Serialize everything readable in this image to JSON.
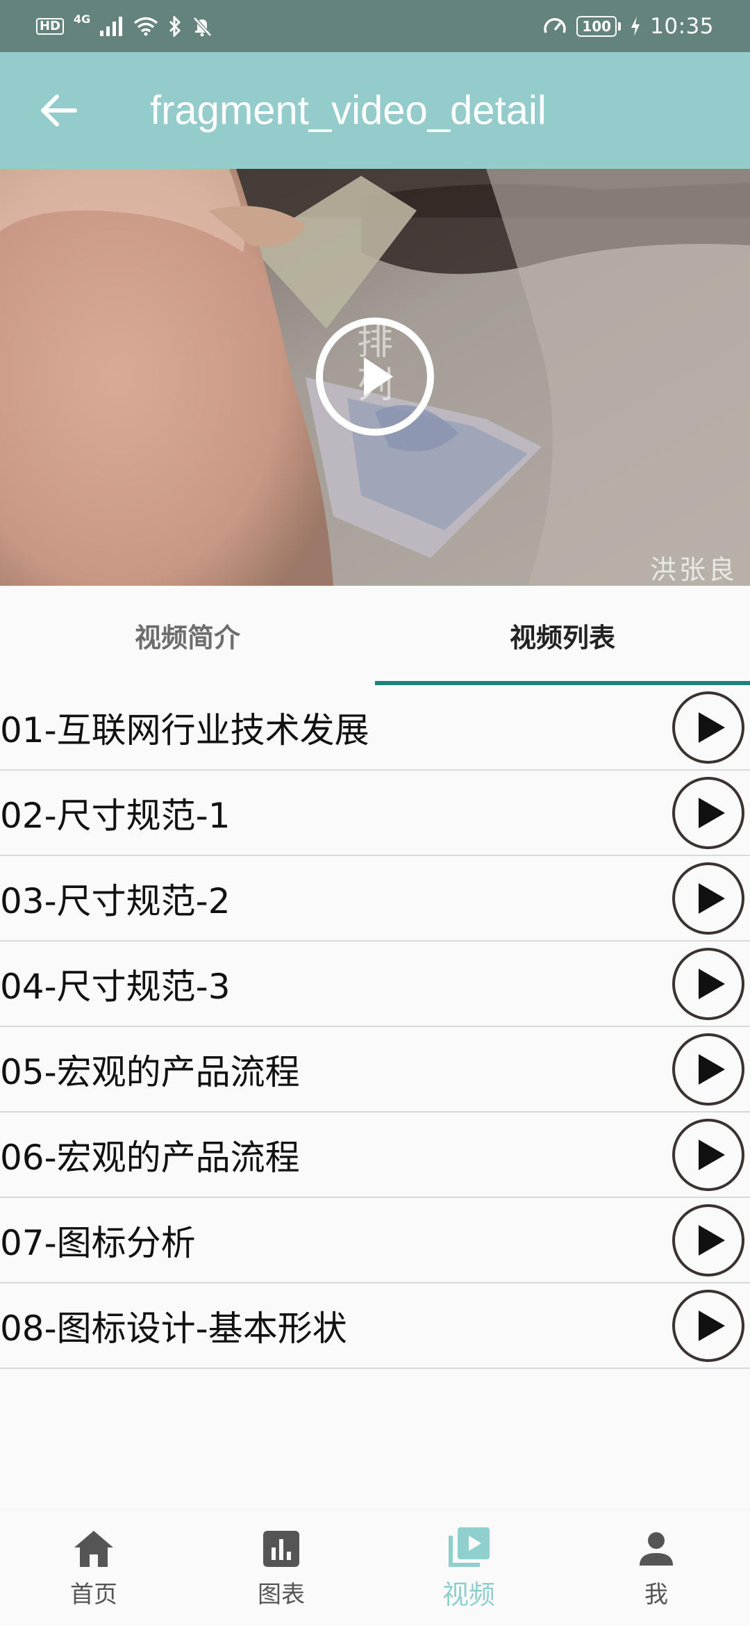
{
  "status_bar": {
    "network_hd": "HD",
    "network_type": "4G",
    "battery": "100",
    "time": "10:35"
  },
  "app_bar": {
    "title": "fragment_video_detail"
  },
  "video": {
    "overlay_caption": "排\n列",
    "watermark": "洪张良"
  },
  "tabs": [
    {
      "label": "视频简介",
      "active": false
    },
    {
      "label": "视频列表",
      "active": true
    }
  ],
  "video_list": [
    {
      "title": "01-互联网行业技术发展"
    },
    {
      "title": "02-尺寸规范-1"
    },
    {
      "title": "03-尺寸规范-2"
    },
    {
      "title": "04-尺寸规范-3"
    },
    {
      "title": "05-宏观的产品流程"
    },
    {
      "title": "06-宏观的产品流程"
    },
    {
      "title": "07-图标分析"
    },
    {
      "title": "08-图标设计-基本形状"
    }
  ],
  "bottom_nav": [
    {
      "label": "首页",
      "icon": "home-icon",
      "active": false
    },
    {
      "label": "图表",
      "icon": "chart-icon",
      "active": false
    },
    {
      "label": "视频",
      "icon": "video-library-icon",
      "active": true
    },
    {
      "label": "我",
      "icon": "person-icon",
      "active": false
    }
  ],
  "colors": {
    "status_bar": "#64837f",
    "app_bar": "#93cccb",
    "tab_indicator": "#1e8479",
    "nav_active": "#8fcfcd"
  }
}
